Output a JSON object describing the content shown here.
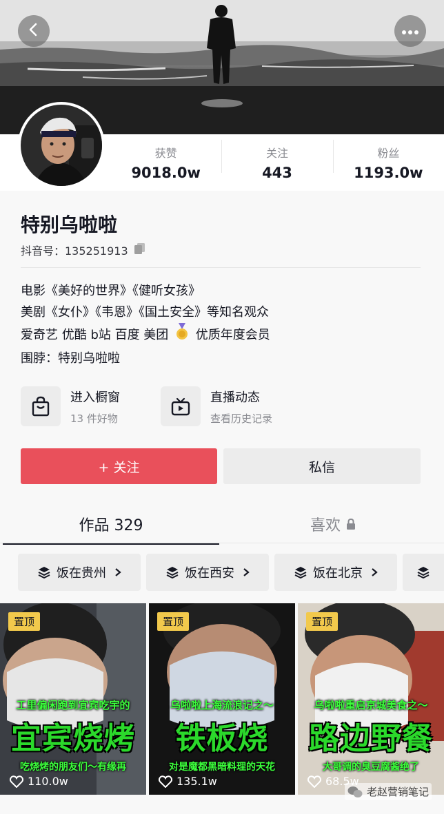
{
  "profile": {
    "name": "特别乌啦啦",
    "id_line": "抖音号：135251913",
    "stats": [
      {
        "label": "获赞",
        "value": "9018.0w"
      },
      {
        "label": "关注",
        "value": "443"
      },
      {
        "label": "粉丝",
        "value": "1193.0w"
      }
    ],
    "bio": [
      "电影《美好的世界》《健听女孩》",
      "美剧《女仆》《韦恩》《国土安全》等知名观众",
      "爱奇艺 优酷 b站 百度 美团",
      "优质年度会员",
      "围脖：特别乌啦啦"
    ]
  },
  "entries": [
    {
      "title": "进入橱窗",
      "subtitle": "13 件好物",
      "icon": "shopping-bag-icon"
    },
    {
      "title": "直播动态",
      "subtitle": "查看历史记录",
      "icon": "tv-icon"
    }
  ],
  "actions": {
    "follow": "+ 关注",
    "message": "私信"
  },
  "tabs": {
    "works": "作品 329",
    "likes": "喜欢"
  },
  "collections": [
    "饭在贵州",
    "饭在西安",
    "饭在北京"
  ],
  "videos": [
    {
      "pin": "置顶",
      "top_text": "工里偏闲跑到宜宾吃宇的",
      "title": "宜宾烧烤",
      "bottom_text": "吃烧烤的朋友们～有缘再",
      "likes": "110.0w"
    },
    {
      "pin": "置顶",
      "top_text": "乌啦啦上海流浪记之～",
      "title": "铁板烧",
      "bottom_text": "对是魔都黑暗料理的天花",
      "likes": "135.1w"
    },
    {
      "pin": "置顶",
      "top_text": "乌啦啦重启京城美食之～",
      "title": "路边野餐",
      "bottom_text": "大哥调的臭豆腐酱绝了",
      "likes": "68.5w"
    }
  ],
  "watermark": "老赵营销笔记",
  "colors": {
    "accent": "#e9505b",
    "pin": "#f2c94c",
    "title_green": "#2bd92b"
  }
}
